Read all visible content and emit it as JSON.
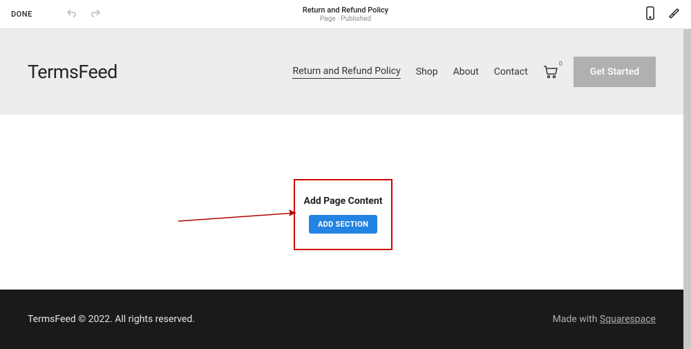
{
  "editor": {
    "done_label": "DONE",
    "page_title": "Return and Refund Policy",
    "page_status": "Page · Published"
  },
  "site": {
    "logo": "TermsFeed",
    "nav": [
      {
        "label": "Return and Refund Policy",
        "active": true
      },
      {
        "label": "Shop",
        "active": false
      },
      {
        "label": "About",
        "active": false
      },
      {
        "label": "Contact",
        "active": false
      }
    ],
    "cart_count": "0",
    "cta_label": "Get Started"
  },
  "content": {
    "add_content_label": "Add Page Content",
    "add_section_label": "ADD SECTION"
  },
  "footer": {
    "copyright": "TermsFeed © 2022. All rights reserved.",
    "made_with_prefix": "Made with ",
    "made_with_link": "Squarespace"
  }
}
